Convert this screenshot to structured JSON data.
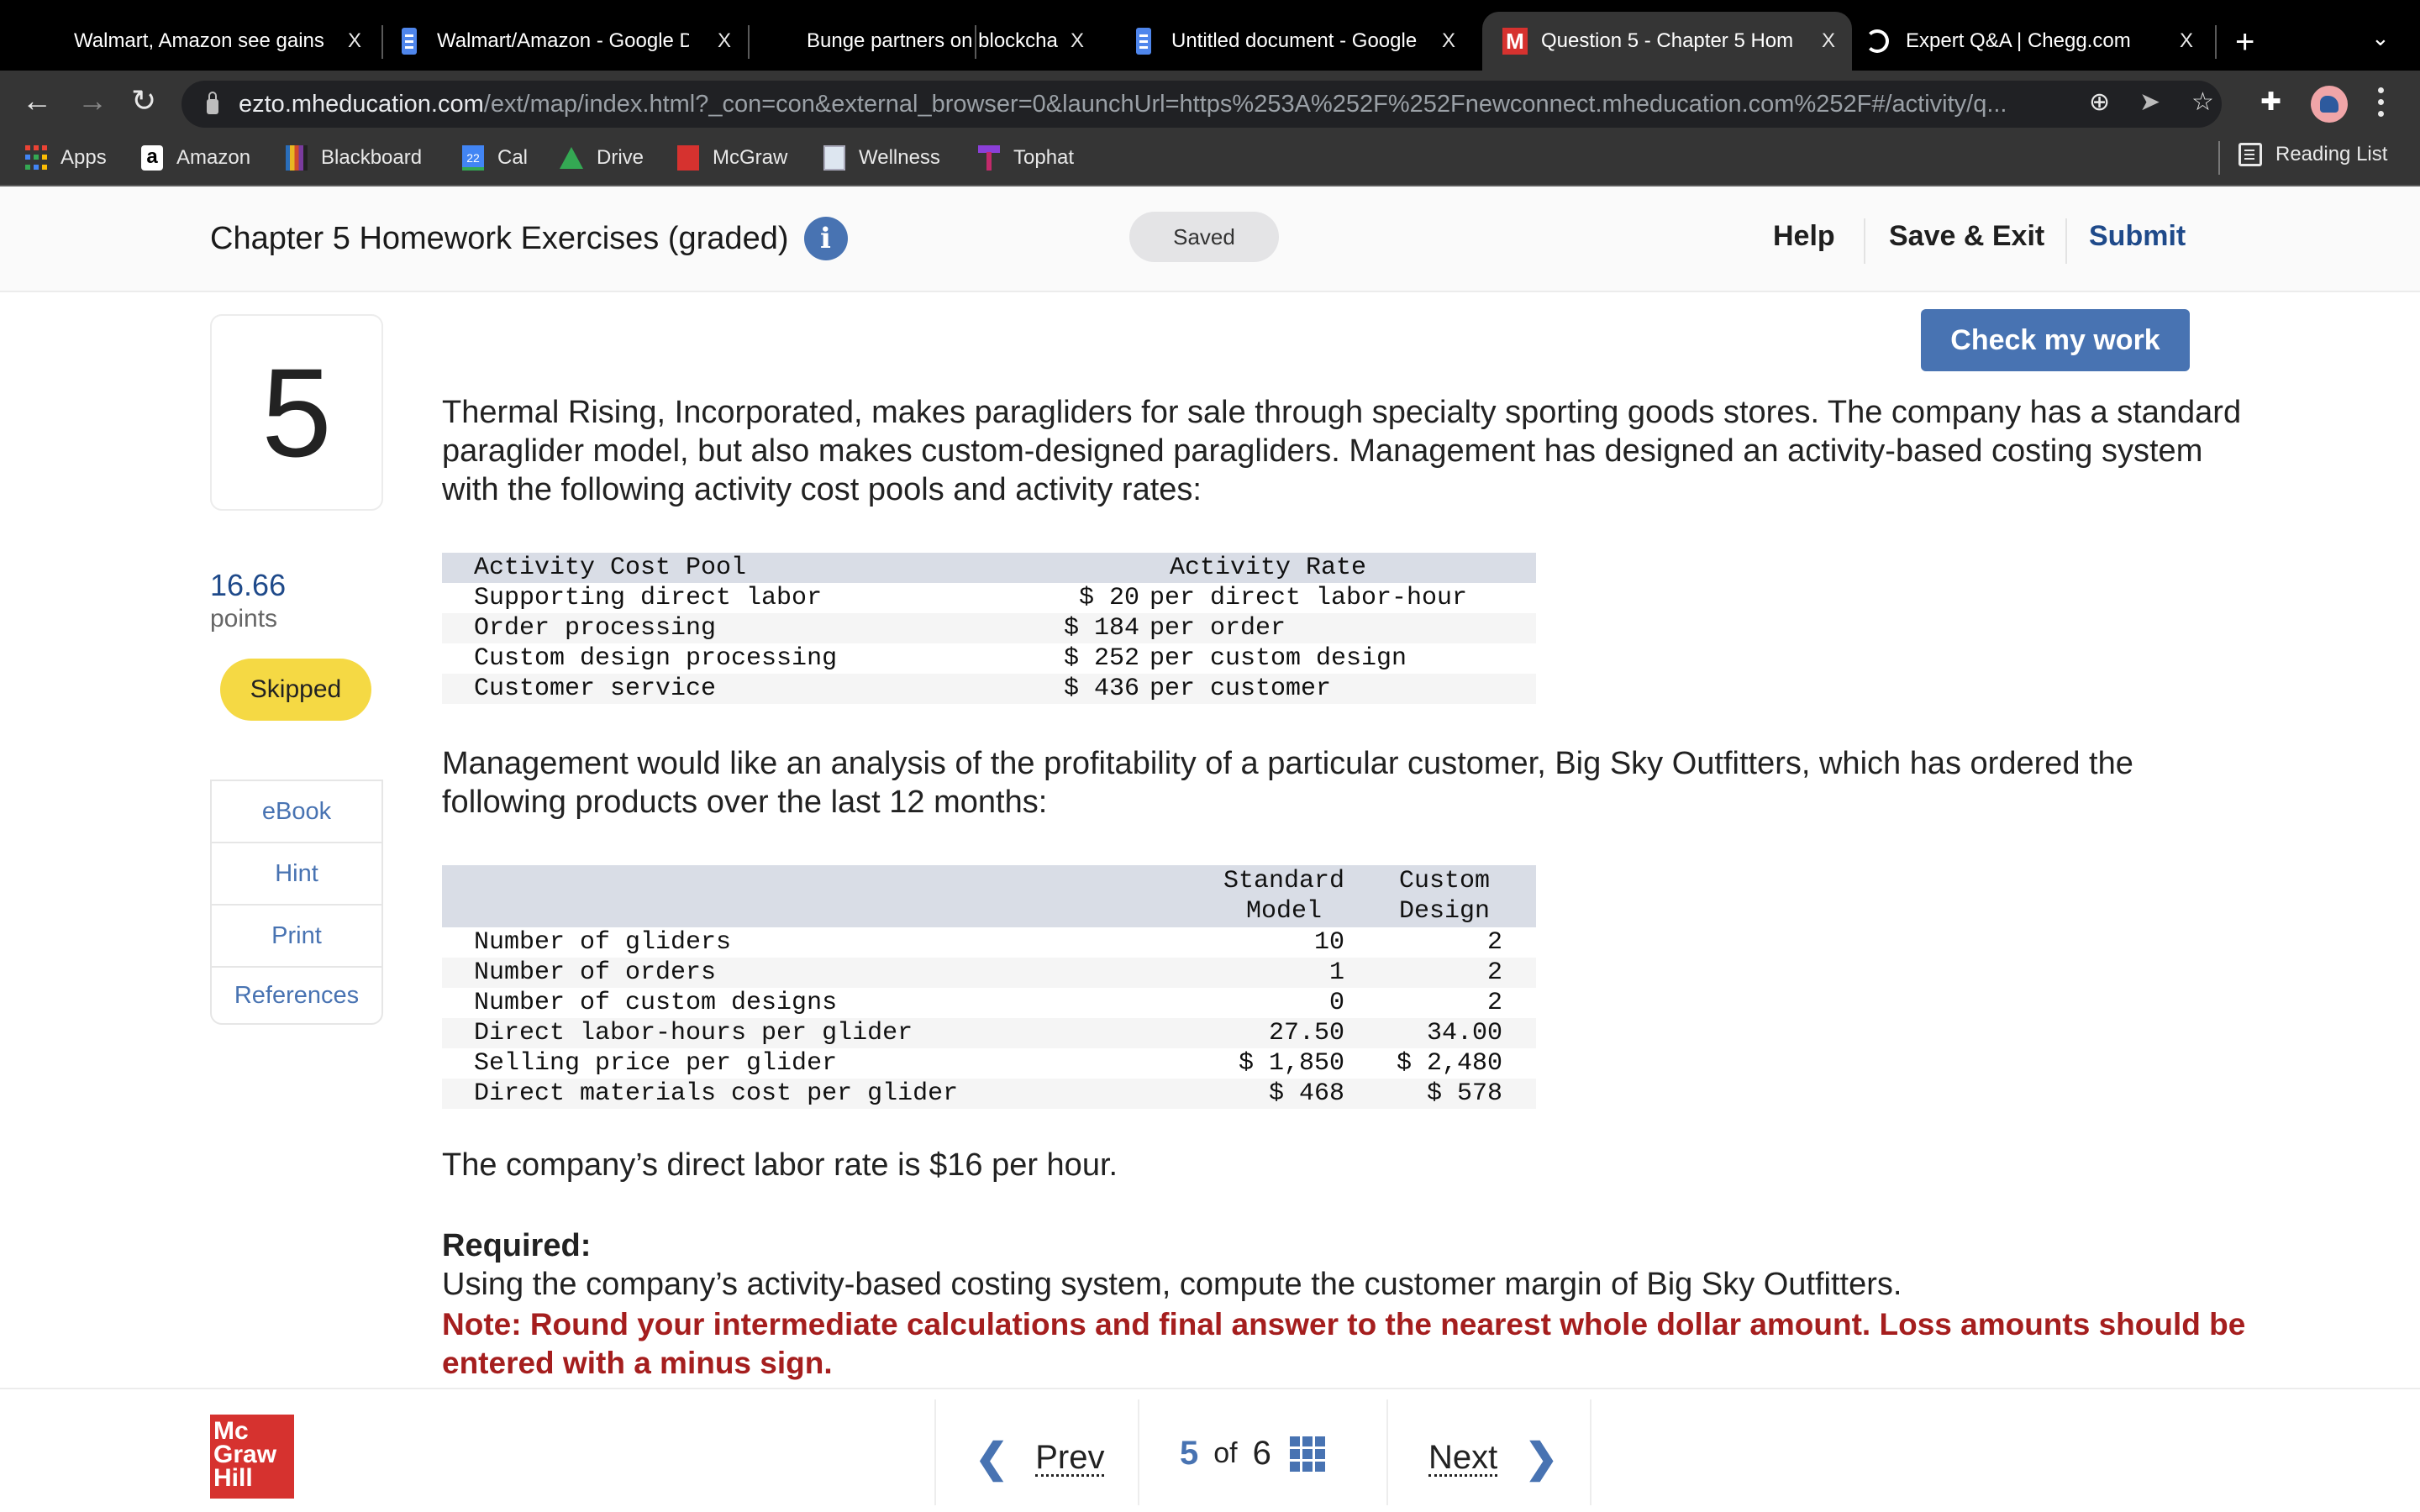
{
  "browser": {
    "tabs": [
      {
        "title": "Walmart, Amazon see gains",
        "icon": "none",
        "active": false
      },
      {
        "title": "Walmart/Amazon - Google D",
        "icon": "google-docs-icon",
        "active": false
      },
      {
        "title": "Bunge partners on blockcha",
        "icon": "none",
        "active": false
      },
      {
        "title": "Untitled document - Google",
        "icon": "google-docs-icon",
        "active": false
      },
      {
        "title": "Question 5 - Chapter 5 Hom",
        "icon": "mcgraw-m-icon",
        "active": true
      },
      {
        "title": "Expert Q&A | Chegg.com",
        "icon": "loading-spinner-icon",
        "active": false
      }
    ],
    "close_glyph": "X",
    "new_tab_glyph": "+",
    "tab_menu_glyph": "⌄",
    "url_host": "ezto.mheducation.com",
    "url_path": "/ext/map/index.html?_con=con&external_browser=0&launchUrl=https%253A%252F%252Fnewconnect.mheducation.com%252F#/activity/q...",
    "bookmarks": [
      {
        "label": "Apps",
        "icon": "apps-grid-icon"
      },
      {
        "label": "Amazon",
        "icon": "amazon-icon"
      },
      {
        "label": "Blackboard",
        "icon": "blackboard-icon"
      },
      {
        "label": "Cal",
        "icon": "calendar-icon",
        "badge": "22"
      },
      {
        "label": "Drive",
        "icon": "drive-icon"
      },
      {
        "label": "McGraw",
        "icon": "mcgraw-icon"
      },
      {
        "label": "Wellness",
        "icon": "wellness-icon"
      },
      {
        "label": "Tophat",
        "icon": "tophat-icon"
      }
    ],
    "reading_list": "Reading List"
  },
  "header": {
    "title": "Chapter 5 Homework Exercises (graded)",
    "info_glyph": "i",
    "status": "Saved",
    "help": "Help",
    "save_exit": "Save & Exit",
    "submit": "Submit"
  },
  "sidebar": {
    "question_number": "5",
    "points": "16.66",
    "points_label": "points",
    "status_badge": "Skipped",
    "tools": [
      "eBook",
      "Hint",
      "Print",
      "References"
    ]
  },
  "main": {
    "check_button": "Check my work",
    "intro": "Thermal Rising, Incorporated, makes paragliders for sale through specialty sporting goods stores. The company has a standard paraglider model, but also makes custom-designed paragliders. Management has designed an activity-based costing system with the following activity cost pools and activity rates:",
    "activity_table": {
      "headers": [
        "Activity Cost Pool",
        "Activity Rate"
      ],
      "rows": [
        {
          "pool": "Supporting direct labor",
          "rate": "$ 20",
          "basis": "per direct labor-hour"
        },
        {
          "pool": "Order processing",
          "rate": "$ 184",
          "basis": "per order"
        },
        {
          "pool": "Custom design processing",
          "rate": "$ 252",
          "basis": "per custom design"
        },
        {
          "pool": "Customer service",
          "rate": "$ 436",
          "basis": "per customer"
        }
      ]
    },
    "analysis_text": "Management would like an analysis of the profitability of a particular customer, Big Sky Outfitters, which has ordered the following products over the last 12 months:",
    "product_table": {
      "headers": [
        "",
        "Standard\nModel",
        "Custom\nDesign"
      ],
      "rows": [
        {
          "label": "Number of gliders",
          "standard": "10",
          "custom": "2"
        },
        {
          "label": "Number of orders",
          "standard": "1",
          "custom": "2"
        },
        {
          "label": "Number of custom designs",
          "standard": "0",
          "custom": "2"
        },
        {
          "label": "Direct labor-hours per glider",
          "standard": "27.50",
          "custom": "34.00"
        },
        {
          "label": "Selling price per glider",
          "standard": "$ 1,850",
          "custom": "$ 2,480"
        },
        {
          "label": "Direct materials cost per glider",
          "standard": "$ 468",
          "custom": "$ 578"
        }
      ]
    },
    "labor_rate_text": "The company’s direct labor rate is $16 per hour.",
    "required_heading": "Required:",
    "required_text": "Using the company’s activity-based costing system, compute the customer margin of Big Sky Outfitters.",
    "note": "Note: Round your intermediate calculations and final answer to the nearest whole dollar amount. Loss amounts should be entered with a minus sign."
  },
  "footer": {
    "logo_lines": [
      "Mc",
      "Graw",
      "Hill"
    ],
    "prev": "Prev",
    "current": "5",
    "of": "of",
    "total": "6",
    "next": "Next",
    "chevron_left": "❮",
    "chevron_right": "❯"
  },
  "colors": {
    "accent_blue": "#4873b2",
    "submit_blue": "#1f4a8a",
    "skipped_yellow": "#f5d944",
    "note_red": "#a51e1e",
    "logo_red": "#d6322f"
  }
}
